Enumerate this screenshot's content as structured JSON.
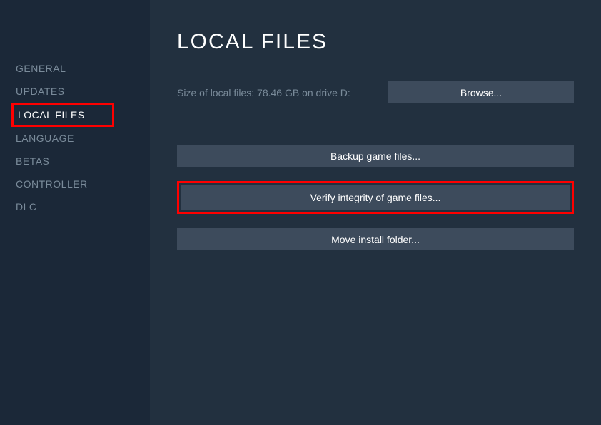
{
  "sidebar": {
    "items": [
      {
        "label": "GENERAL"
      },
      {
        "label": "UPDATES"
      },
      {
        "label": "LOCAL FILES"
      },
      {
        "label": "LANGUAGE"
      },
      {
        "label": "BETAS"
      },
      {
        "label": "CONTROLLER"
      },
      {
        "label": "DLC"
      }
    ]
  },
  "main": {
    "title": "LOCAL FILES",
    "size_label": "Size of local files: 78.46 GB on drive D:",
    "browse_label": "Browse...",
    "backup_label": "Backup game files...",
    "verify_label": "Verify integrity of game files...",
    "move_label": "Move install folder..."
  }
}
